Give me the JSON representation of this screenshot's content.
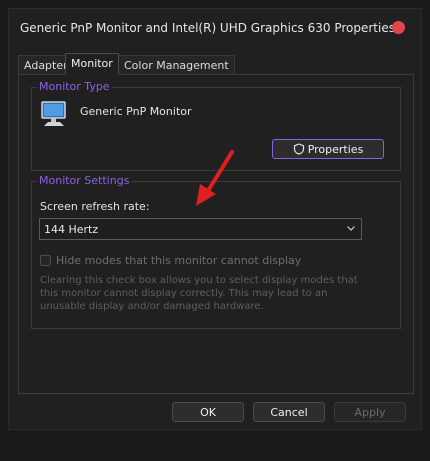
{
  "window": {
    "title": "Generic PnP Monitor and Intel(R) UHD Graphics 630 Properties"
  },
  "tabs": [
    {
      "label": "Adapter"
    },
    {
      "label": "Monitor"
    },
    {
      "label": "Color Management"
    }
  ],
  "monitor_type": {
    "group_title": "Monitor Type",
    "monitor_name": "Generic PnP Monitor",
    "properties_label": "Properties"
  },
  "monitor_settings": {
    "group_title": "Monitor Settings",
    "refresh_label": "Screen refresh rate:",
    "refresh_value": "144 Hertz",
    "hide_modes_label": "Hide modes that this monitor cannot display",
    "hide_modes_checked": false,
    "description": "Clearing this check box allows you to select display modes that this monitor cannot display correctly. This may lead to an unusable display and/or damaged hardware."
  },
  "buttons": {
    "ok": "OK",
    "cancel": "Cancel",
    "apply": "Apply"
  },
  "colors": {
    "accent": "#8a62e0",
    "arrow": "#e02020",
    "close": "#e0464a"
  },
  "icons": {
    "monitor": "monitor-icon",
    "shield": "shield-icon",
    "chevron": "chevron-down-icon",
    "arrow": "red-arrow-annotation"
  }
}
